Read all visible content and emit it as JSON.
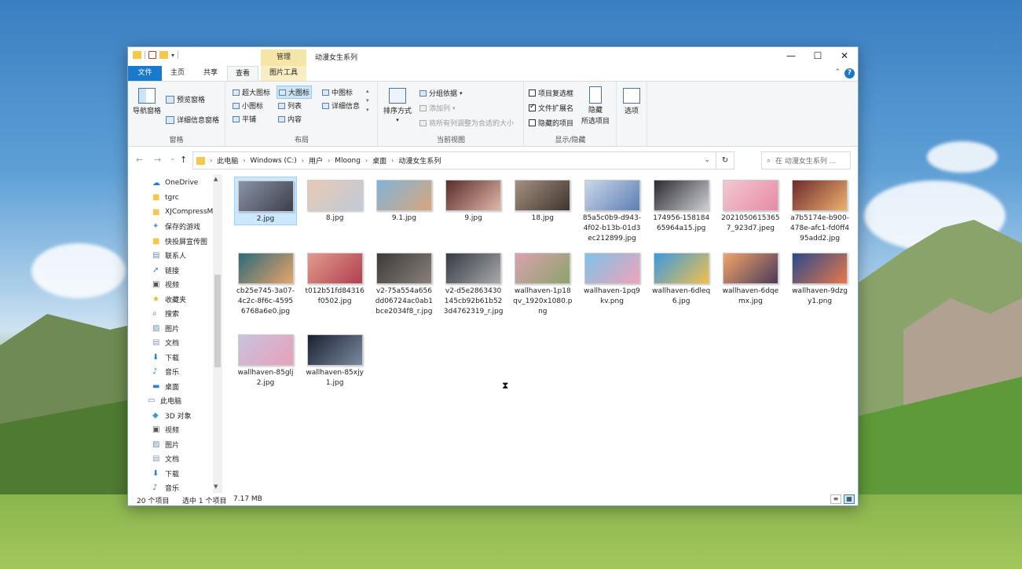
{
  "window": {
    "title": "动漫女生系列",
    "context_tab": "管理",
    "controls": {
      "minimize": "—",
      "maximize": "☐",
      "close": "✕"
    }
  },
  "quick_access": {
    "dropdown": "▾"
  },
  "tabs": [
    "文件",
    "主页",
    "共享",
    "查看",
    "图片工具"
  ],
  "help": "?",
  "ribbon": {
    "panes": {
      "label": "窗格",
      "nav_pane": "导航窗格",
      "preview_pane": "预览窗格",
      "details_pane": "详细信息窗格"
    },
    "layout": {
      "label": "布局",
      "options": [
        "超大图标",
        "大图标",
        "中图标",
        "小图标",
        "列表",
        "详细信息",
        "平铺",
        "内容"
      ],
      "selected": "大图标"
    },
    "current_view": {
      "label": "当前视图",
      "sort_by": "排序方式",
      "group_by": "分组依据",
      "add_columns": "添加列",
      "size_all_columns": "将所有列调整为合适的大小"
    },
    "show_hide": {
      "label": "显示/隐藏",
      "item_checkboxes": "项目复选框",
      "file_extensions": "文件扩展名",
      "hidden_items": "隐藏的项目",
      "hide_selected": "隐藏\n所选项目",
      "hide_selected_line1": "隐藏",
      "hide_selected_line2": "所选项目",
      "checkbox_states": {
        "item_checkboxes": false,
        "file_extensions": true,
        "hidden_items": false
      }
    },
    "options": "选项"
  },
  "address": {
    "back": "←",
    "forward": "→",
    "recent": "⌄",
    "up": "↑",
    "breadcrumb": [
      "此电脑",
      "Windows (C:)",
      "用户",
      "Mloong",
      "桌面",
      "动漫女生系列"
    ],
    "refresh": "↻",
    "search_placeholder": "在 动漫女生系列 ..."
  },
  "nav": [
    {
      "label": "OneDrive",
      "icon": "cloud-icon",
      "color": "#1e7fd6"
    },
    {
      "label": "tgrc",
      "icon": "folder-icon",
      "color": "#f5c84c"
    },
    {
      "label": "XJCompressM",
      "icon": "folder-icon",
      "color": "#f5c84c"
    },
    {
      "label": "保存的游戏",
      "icon": "puzzle-icon",
      "color": "#5a8fd6"
    },
    {
      "label": "快投屏宣传图",
      "icon": "folder-icon",
      "color": "#f5c84c"
    },
    {
      "label": "联系人",
      "icon": "contacts-icon",
      "color": "#6a8fb5"
    },
    {
      "label": "链接",
      "icon": "link-icon",
      "color": "#2f7fd6"
    },
    {
      "label": "视频",
      "icon": "video-icon",
      "color": "#555"
    },
    {
      "label": "收藏夹",
      "icon": "star-icon",
      "color": "#f0b429"
    },
    {
      "label": "搜索",
      "icon": "search-icon",
      "color": "#666"
    },
    {
      "label": "图片",
      "icon": "pictures-icon",
      "color": "#6a8fb5"
    },
    {
      "label": "文档",
      "icon": "document-icon",
      "color": "#8a9bb0"
    },
    {
      "label": "下载",
      "icon": "download-icon",
      "color": "#2f7fd6"
    },
    {
      "label": "音乐",
      "icon": "music-icon",
      "color": "#2f7fd6"
    },
    {
      "label": "桌面",
      "icon": "desktop-icon",
      "color": "#2f7fd6"
    },
    {
      "label": "此电脑",
      "icon": "computer-icon",
      "color": "#3a8ad6"
    },
    {
      "label": "3D 对象",
      "icon": "cube-icon",
      "color": "#3a9ad6"
    },
    {
      "label": "视频",
      "icon": "video-icon",
      "color": "#555"
    },
    {
      "label": "图片",
      "icon": "pictures-icon",
      "color": "#6a8fb5"
    },
    {
      "label": "文档",
      "icon": "document-icon",
      "color": "#8a9bb0"
    },
    {
      "label": "下载",
      "icon": "download-icon",
      "color": "#2f7fd6"
    },
    {
      "label": "音乐",
      "icon": "music-icon",
      "color": "#2f7fd6"
    }
  ],
  "files": [
    {
      "label": "2.jpg",
      "selected": true,
      "c1": "#8a93a8",
      "c2": "#3d3f4a"
    },
    {
      "label": "8.jpg",
      "c1": "#e8c9b5",
      "c2": "#c0cbd8"
    },
    {
      "label": "9.1.jpg",
      "c1": "#7fb3d9",
      "c2": "#d9a67a"
    },
    {
      "label": "9.jpg",
      "c1": "#5a2b2b",
      "c2": "#e0b8a8"
    },
    {
      "label": "18.jpg",
      "c1": "#a69080",
      "c2": "#3d3530"
    },
    {
      "label": "85a5c0b9-d943-4f02-b13b-01d3ec212899.jpg",
      "c1": "#c9d7ea",
      "c2": "#5d7fb3"
    },
    {
      "label": "174956-15818465964a15.jpg",
      "c1": "#2a2a30",
      "c2": "#cfcfd6"
    },
    {
      "label": "20210506153657_923d7.jpeg",
      "c1": "#f2c9d3",
      "c2": "#e88aa3"
    },
    {
      "label": "a7b5174e-b900-478e-afc1-fd0ff495add2.jpg",
      "c1": "#6b2b2b",
      "c2": "#f0b070"
    },
    {
      "label": "cb25e745-3a07-4c2c-8f6c-45956768a6e0.jpg",
      "c1": "#2d6a7a",
      "c2": "#e8a468"
    },
    {
      "label": "t012b51fd84316f0502.jpg",
      "c1": "#e39a8c",
      "c2": "#b04050"
    },
    {
      "label": "v2-75a554a656dd06724ac0ab1bce2034f8_r.jpg",
      "c1": "#3b3b3b",
      "c2": "#8a8078"
    },
    {
      "label": "v2-d5e2863430145cb92b61b523d4762319_r.jpg",
      "c1": "#353b42",
      "c2": "#a7a9ad"
    },
    {
      "label": "wallhaven-1p18qv_1920x1080.png",
      "c1": "#d9a3b0",
      "c2": "#8da36a"
    },
    {
      "label": "wallhaven-1pq9kv.png",
      "c1": "#7ec3ea",
      "c2": "#f0a3b8"
    },
    {
      "label": "wallhaven-6dleq6.jpg",
      "c1": "#3a9ae0",
      "c2": "#f2c04a"
    },
    {
      "label": "wallhaven-6dqemx.jpg",
      "c1": "#f2a46a",
      "c2": "#4a3a5a"
    },
    {
      "label": "wallhaven-9dzgy1.png",
      "c1": "#2a4a8a",
      "c2": "#e8784a"
    },
    {
      "label": "wallhaven-85glj2.jpg",
      "c1": "#c9c3e0",
      "c2": "#e8a0b8"
    },
    {
      "label": "wallhaven-85xjy1.jpg",
      "c1": "#1a2030",
      "c2": "#7a8aa0"
    }
  ],
  "status": {
    "count": "20 个项目",
    "selected": "选中 1 个项目",
    "size": "7.17 MB"
  }
}
